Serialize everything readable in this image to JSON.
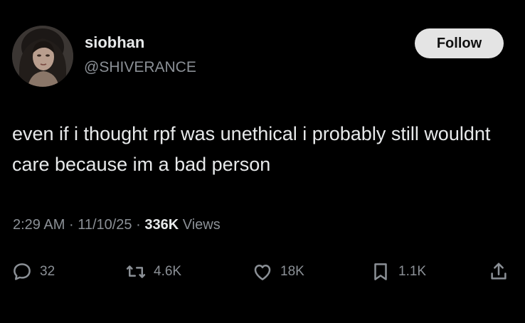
{
  "user": {
    "display_name": "siobhan",
    "handle": "@SHIVERANCE"
  },
  "follow_button": {
    "label": "Follow"
  },
  "tweet": {
    "text": "even if i thought rpf was unethical i probably still wouldnt care because im a bad person"
  },
  "meta": {
    "time": "2:29 AM",
    "separator": "·",
    "date": "11/10/25",
    "views_count": "336K",
    "views_label": "Views"
  },
  "actions": {
    "replies": {
      "icon": "reply-icon",
      "count": "32"
    },
    "retweets": {
      "icon": "retweet-icon",
      "count": "4.6K"
    },
    "likes": {
      "icon": "heart-icon",
      "count": "18K"
    },
    "bookmarks": {
      "icon": "bookmark-icon",
      "count": "1.1K"
    },
    "share": {
      "icon": "share-icon"
    }
  },
  "colors": {
    "background": "#000000",
    "primary_text": "#e7e9ea",
    "secondary_text": "#8b9096",
    "follow_button_bg": "#e4e4e4"
  }
}
